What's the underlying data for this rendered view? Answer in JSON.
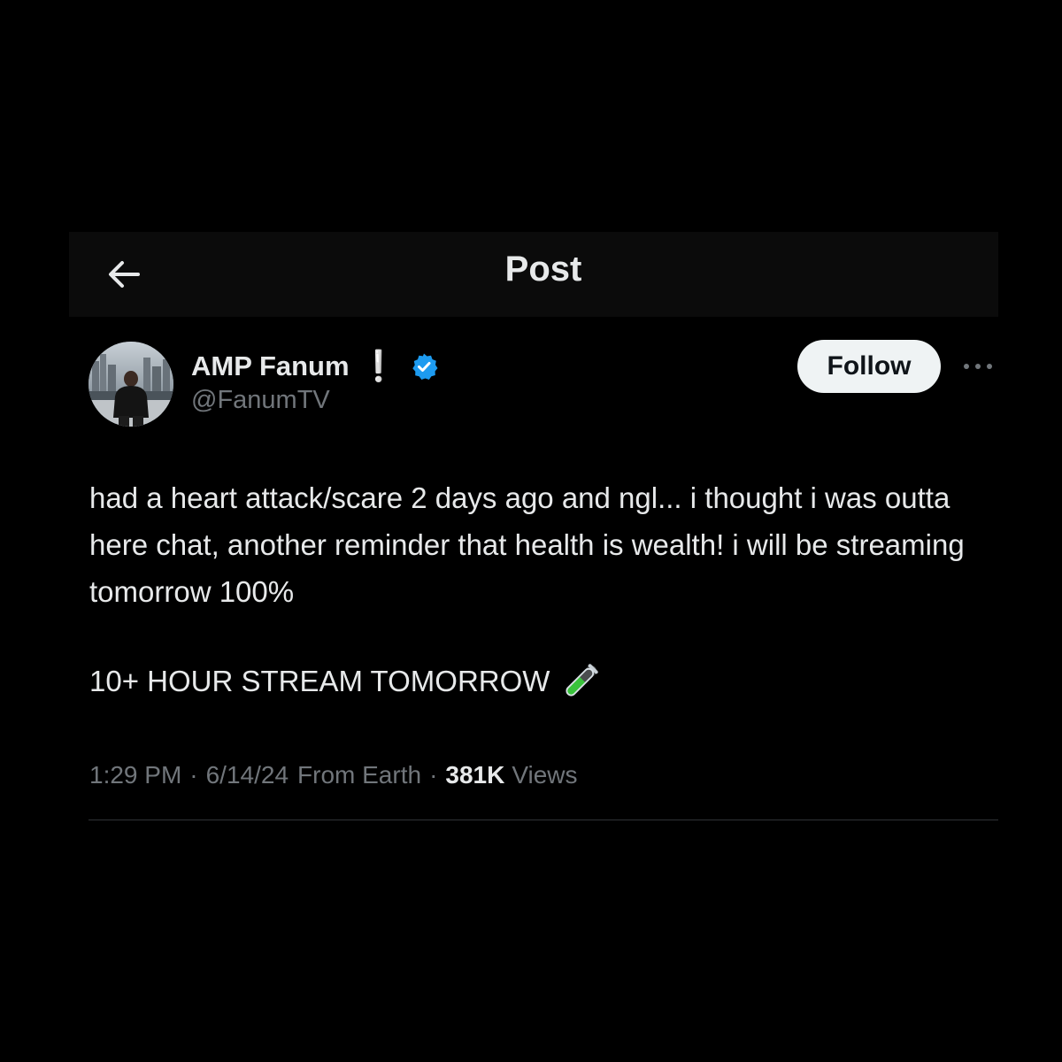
{
  "header": {
    "title": "Post",
    "back_icon": "arrow-left-icon"
  },
  "author": {
    "display_name": "AMP Fanum",
    "name_emoji": "❕",
    "handle": "@FanumTV",
    "verified": true,
    "verified_color": "#1d9bf0",
    "avatar_icon": "profile-photo"
  },
  "actions": {
    "follow_label": "Follow",
    "more_icon": "more-horizontal-icon"
  },
  "tweet": {
    "text": "had a heart attack/scare 2 days ago and ngl... i thought i was outta here chat, another reminder that health is wealth! i will be streaming tomorrow 100%",
    "text2": "10+ HOUR STREAM TOMORROW",
    "emoji_icon": "test-tube-icon"
  },
  "meta": {
    "time": "1:29 PM",
    "date": "6/14/24",
    "location": "From Earth",
    "views_count": "381K",
    "views_label": "Views",
    "separator": "·"
  },
  "colors": {
    "background": "#000000",
    "header_bg": "#0b0b0b",
    "text_primary": "#e7e9ea",
    "text_secondary": "#71767b",
    "follow_bg": "#eff3f4",
    "divider": "#2f3336"
  }
}
